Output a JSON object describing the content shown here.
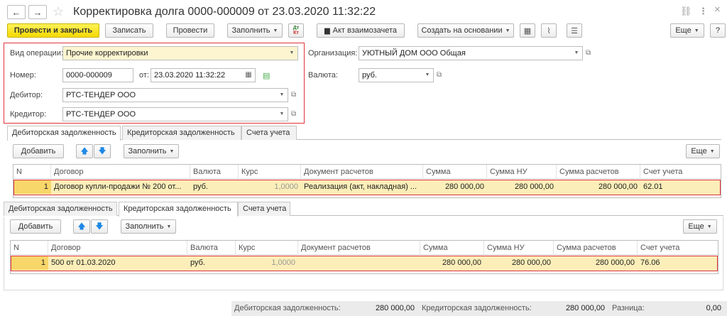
{
  "window": {
    "title": "Корректировка долга 0000-000009 от 23.03.2020 11:32:22",
    "back_icon": "←",
    "forward_icon": "→",
    "star_icon": "☆",
    "link_icon": "⛓",
    "more_icon": "⋮",
    "close_icon": "×"
  },
  "toolbar": {
    "post_close": "Провести и закрыть",
    "save": "Записать",
    "post": "Провести",
    "fill": "Заполнить",
    "dtkt_top": "Дт",
    "dtkt_bottom": "Кт",
    "offset_act": "Акт взаимозачета",
    "create_based": "Создать на основании",
    "more": "Еще",
    "help": "?"
  },
  "form": {
    "operation_label": "Вид операции:",
    "operation_value": "Прочие корректировки",
    "number_label": "Номер:",
    "number_value": "0000-000009",
    "date_label": "от:",
    "date_value": "23.03.2020 11:32:22",
    "debtor_label": "Дебитор:",
    "debtor_value": "РТС-ТЕНДЕР ООО",
    "creditor_label": "Кредитор:",
    "creditor_value": "РТС-ТЕНДЕР ООО",
    "org_label": "Организация:",
    "org_value": "УЮТНЫЙ ДОМ ООО  Общая",
    "currency_label": "Валюта:",
    "currency_value": "руб."
  },
  "tabs": [
    "Дебиторская задолженность",
    "Кредиторская задолженность",
    "Счета учета"
  ],
  "table_toolbar": {
    "add": "Добавить",
    "up_icon": "🡅",
    "down_icon": "🡇",
    "fill": "Заполнить",
    "more": "Еще"
  },
  "columns": [
    "N",
    "Договор",
    "Валюта",
    "Курс",
    "Документ расчетов",
    "Сумма",
    "Сумма НУ",
    "Сумма расчетов",
    "Счет учета"
  ],
  "debit_rows": [
    {
      "n": "1",
      "contract": "Договор купли-продажи № 200 от...",
      "currency": "руб.",
      "rate": "1,0000",
      "doc": "Реализация (акт, накладная) ...",
      "sum": "280 000,00",
      "sum_nu": "280 000,00",
      "sum_calc": "280 000,00",
      "account": "62.01"
    }
  ],
  "credit_rows": [
    {
      "n": "1",
      "contract": "500 от 01.03.2020",
      "currency": "руб.",
      "rate": "1,0000",
      "doc": "",
      "sum": "280 000,00",
      "sum_nu": "280 000,00",
      "sum_calc": "280 000,00",
      "account": "76.06"
    }
  ],
  "footer": {
    "debit_label": "Дебиторская задолженность:",
    "debit_value": "280 000,00",
    "credit_label": "Кредиторская задолженность:",
    "credit_value": "280 000,00",
    "diff_label": "Разница:",
    "diff_value": "0,00"
  },
  "colors": {
    "primary_button": "#f5d900",
    "selected_row": "#fbeeb8",
    "highlight_frame": "#e0333a"
  }
}
